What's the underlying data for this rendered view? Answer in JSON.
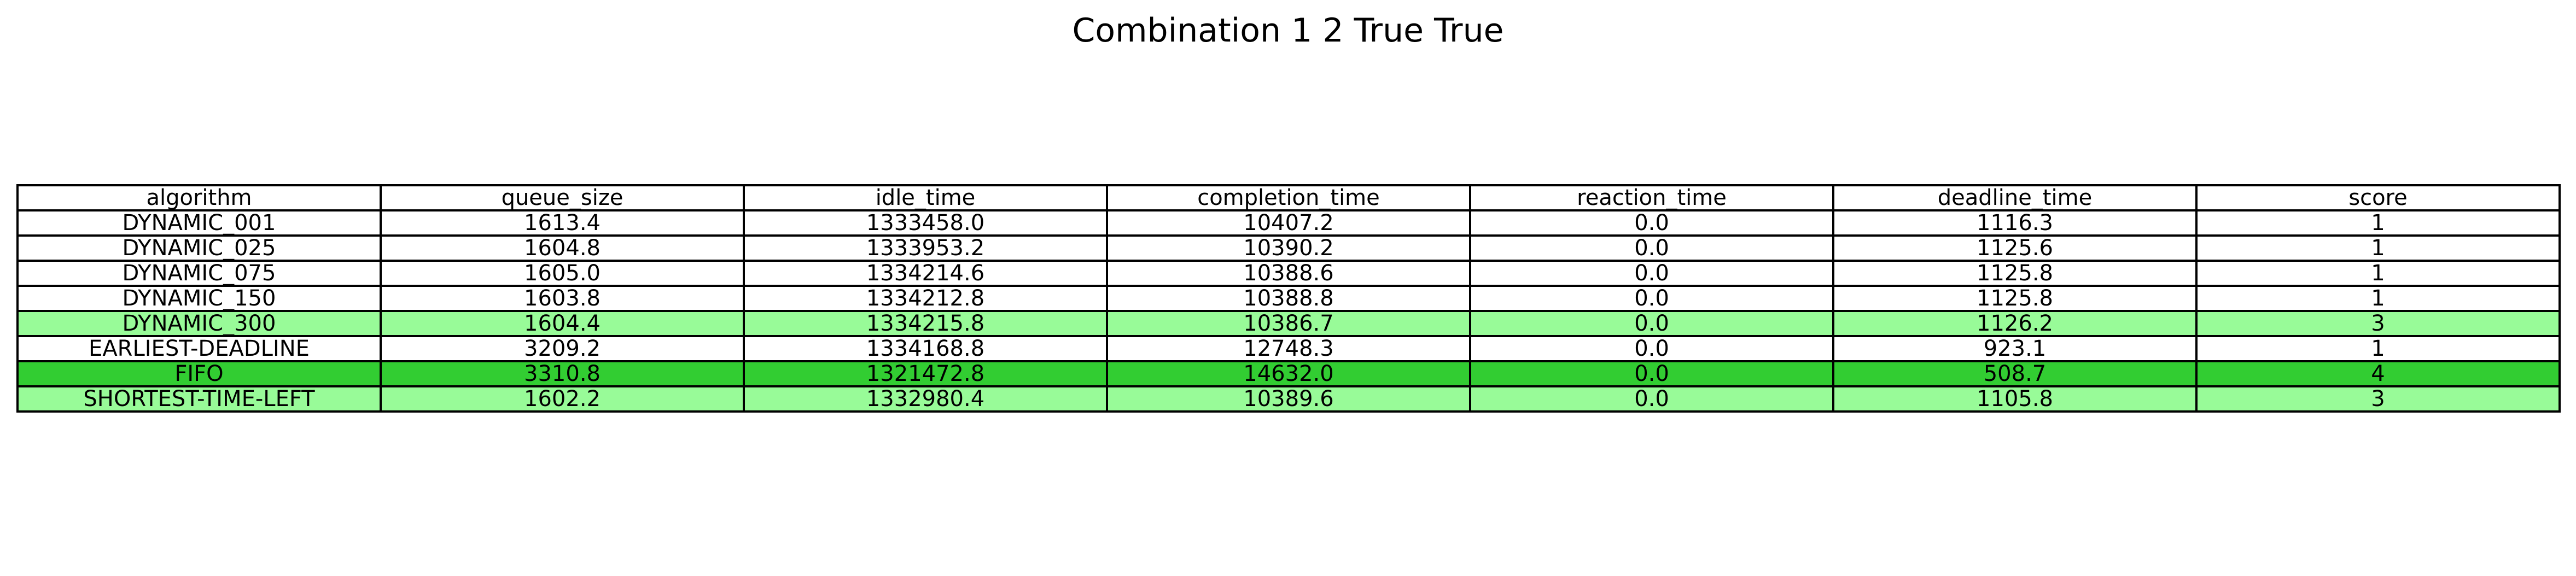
{
  "chart_data": {
    "type": "table",
    "title": "Combination 1 2 True True",
    "columns": [
      "algorithm",
      "queue_size",
      "idle_time",
      "completion_time",
      "reaction_time",
      "deadline_time",
      "score"
    ],
    "rows": [
      {
        "cells": [
          "DYNAMIC_001",
          "1613.4",
          "1333458.0",
          "10407.2",
          "0.0",
          "1116.3",
          "1"
        ],
        "highlight": "#ffffff"
      },
      {
        "cells": [
          "DYNAMIC_025",
          "1604.8",
          "1333953.2",
          "10390.2",
          "0.0",
          "1125.6",
          "1"
        ],
        "highlight": "#ffffff"
      },
      {
        "cells": [
          "DYNAMIC_075",
          "1605.0",
          "1334214.6",
          "10388.6",
          "0.0",
          "1125.8",
          "1"
        ],
        "highlight": "#ffffff"
      },
      {
        "cells": [
          "DYNAMIC_150",
          "1603.8",
          "1334212.8",
          "10388.8",
          "0.0",
          "1125.8",
          "1"
        ],
        "highlight": "#ffffff"
      },
      {
        "cells": [
          "DYNAMIC_300",
          "1604.4",
          "1334215.8",
          "10386.7",
          "0.0",
          "1126.2",
          "3"
        ],
        "highlight": "#98fb98"
      },
      {
        "cells": [
          "EARLIEST-DEADLINE",
          "3209.2",
          "1334168.8",
          "12748.3",
          "0.0",
          "923.1",
          "1"
        ],
        "highlight": "#ffffff"
      },
      {
        "cells": [
          "FIFO",
          "3310.8",
          "1321472.8",
          "14632.0",
          "0.0",
          "508.7",
          "4"
        ],
        "highlight": "#32cd32"
      },
      {
        "cells": [
          "SHORTEST-TIME-LEFT",
          "1602.2",
          "1332980.4",
          "10389.6",
          "0.0",
          "1105.8",
          "3"
        ],
        "highlight": "#98fb98"
      }
    ]
  }
}
